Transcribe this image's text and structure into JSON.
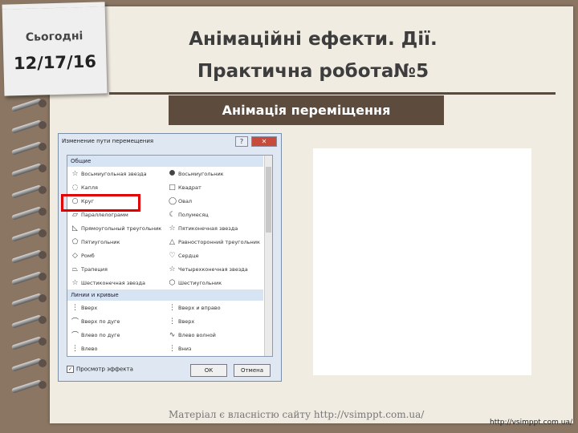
{
  "header": {
    "today_label": "Сьогодні",
    "date": "12/17/16",
    "title_line1": "Анімаційні ефекти. Дії.",
    "title_line2": "Практична робота№5",
    "subtitle": "Анімація переміщення"
  },
  "dialog": {
    "title": "Изменение пути перемещения",
    "help_label": "?",
    "close_label": "✕",
    "groups": [
      {
        "label": "Общие",
        "items": [
          {
            "label": "Восьмиугольная звезда",
            "icon": "star-icon"
          },
          {
            "label": "Восьмиугольник",
            "icon": "octagon-icon"
          },
          {
            "label": "Капля",
            "icon": "drop-icon"
          },
          {
            "label": "Квадрат",
            "icon": "square-icon"
          },
          {
            "label": "Круг",
            "icon": "circle-icon"
          },
          {
            "label": "Овал",
            "icon": "oval-icon"
          },
          {
            "label": "Параллелограмм",
            "icon": "parallelogram-icon"
          },
          {
            "label": "Полумесяц",
            "icon": "crescent-icon"
          },
          {
            "label": "Прямоугольный треугольник",
            "icon": "right-triangle-icon"
          },
          {
            "label": "Пятиконечная звезда",
            "icon": "star-icon"
          },
          {
            "label": "Пятиугольник",
            "icon": "pentagon-icon"
          },
          {
            "label": "Равносторонний треугольник",
            "icon": "triangle-icon"
          },
          {
            "label": "Ромб",
            "icon": "diamond-icon"
          },
          {
            "label": "Сердце",
            "icon": "heart-icon"
          },
          {
            "label": "Трапеция",
            "icon": "trapezoid-icon"
          },
          {
            "label": "Четырехконечная звезда",
            "icon": "star-icon"
          },
          {
            "label": "Шестиконечная звезда",
            "icon": "star-icon"
          },
          {
            "label": "Шестиугольник",
            "icon": "hexagon-icon"
          }
        ]
      },
      {
        "label": "Линии и кривые",
        "items": [
          {
            "label": "Вверх",
            "icon": "line-icon"
          },
          {
            "label": "Вверх и вправо",
            "icon": "line-icon"
          },
          {
            "label": "Вверх по дуге",
            "icon": "arc-icon"
          },
          {
            "label": "Вверх",
            "icon": "line-icon"
          },
          {
            "label": "Влево по дуге",
            "icon": "arc-icon"
          },
          {
            "label": "Влево волной",
            "icon": "wave-icon"
          },
          {
            "label": "Влево",
            "icon": "line-icon"
          },
          {
            "label": "Вниз",
            "icon": "line-icon"
          }
        ]
      }
    ],
    "preview_label": "Просмотр эффекта",
    "preview_checked": true,
    "ok_label": "ОК",
    "cancel_label": "Отмена"
  },
  "footer": {
    "credit": "Матеріал є власністю сайту http://vsimppt.com.ua/",
    "url": "http://vsimppt.com.ua/"
  },
  "colors": {
    "background": "#8a7663",
    "paper": "#f1ece2",
    "banner": "#5d4b3d",
    "highlight": "#e00000"
  }
}
